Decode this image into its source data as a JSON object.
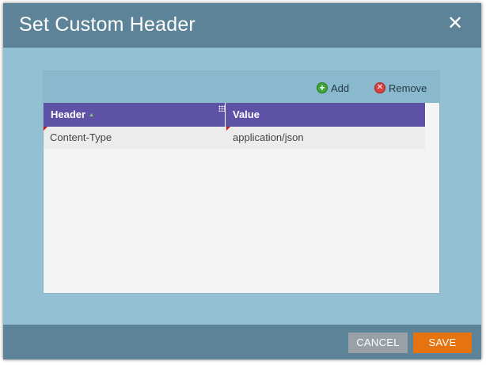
{
  "dialog": {
    "title": "Set Custom Header",
    "close_icon": "close-icon"
  },
  "toolbar": {
    "add_label": "Add",
    "remove_label": "Remove",
    "add_icon": "add-circle-icon",
    "remove_icon": "remove-circle-icon"
  },
  "grid": {
    "columns": [
      {
        "label": "Header",
        "sorted": true
      },
      {
        "label": "Value"
      }
    ],
    "rows": [
      {
        "header": "Content-Type",
        "value": "application/json",
        "edited": true
      }
    ]
  },
  "footer": {
    "cancel_label": "CANCEL",
    "save_label": "SAVE"
  },
  "colors": {
    "titlebar": "#5c8397",
    "body": "#93c0d2",
    "grid_header": "#5d52a6",
    "save_button": "#e5730f",
    "cancel_button": "#9aa1a6",
    "add_icon": "#3ea53a",
    "remove_icon": "#d64040"
  }
}
